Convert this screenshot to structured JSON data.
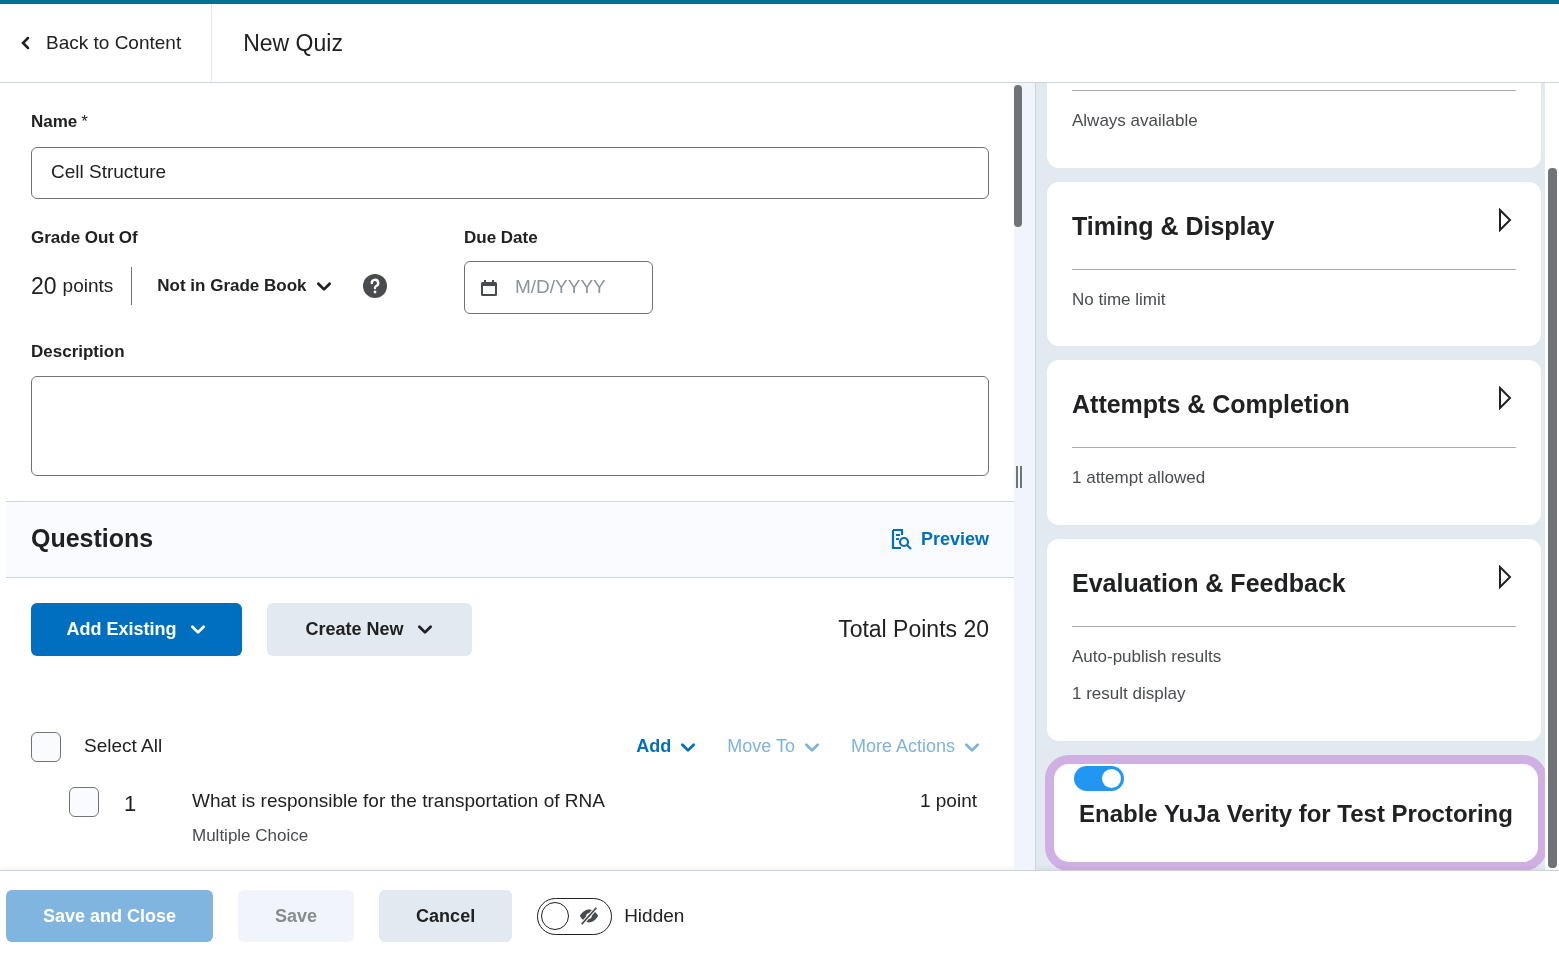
{
  "header": {
    "back_link": "Back to Content",
    "title": "New Quiz"
  },
  "form": {
    "name_label": "Name",
    "required_mark": "*",
    "name_value": "Cell Structure",
    "grade_label": "Grade Out Of",
    "grade_value": "20",
    "grade_unit": "points",
    "grade_book": "Not in Grade Book",
    "due_label": "Due Date",
    "due_placeholder": "M/D/YYYY",
    "description_label": "Description"
  },
  "questions": {
    "title": "Questions",
    "preview": "Preview",
    "add_existing": "Add Existing",
    "create_new": "Create New",
    "total_points": "Total Points 20",
    "select_all": {
      "label": "Select All",
      "checked": false
    },
    "actions": [
      {
        "label": "Add",
        "disabled": false
      },
      {
        "label": "Move To",
        "disabled": true
      },
      {
        "label": "More Actions",
        "disabled": true
      }
    ],
    "items": [
      {
        "number": "1",
        "text": "What is responsible for the transportation of RNA",
        "type": "Multiple Choice",
        "points": "1 point",
        "checked": false
      }
    ]
  },
  "settings": {
    "cards": [
      {
        "summary": [
          "Always available"
        ]
      },
      {
        "title": "Timing & Display",
        "summary": [
          "No time limit"
        ]
      },
      {
        "title": "Attempts & Completion",
        "summary": [
          "1 attempt allowed"
        ]
      },
      {
        "title": "Evaluation & Feedback",
        "summary": [
          "Auto-publish results",
          "1 result display"
        ]
      }
    ],
    "proctoring": {
      "label": "Enable YuJa Verity for Test Proctoring",
      "on": true
    }
  },
  "footer": {
    "buttons": [
      {
        "label": "Save and Close",
        "kind": "primary",
        "disabled": true
      },
      {
        "label": "Save",
        "kind": "secondary",
        "disabled": true
      },
      {
        "label": "Cancel",
        "kind": "secondary",
        "disabled": false
      }
    ],
    "visibility": {
      "label": "Hidden",
      "on": false
    }
  }
}
